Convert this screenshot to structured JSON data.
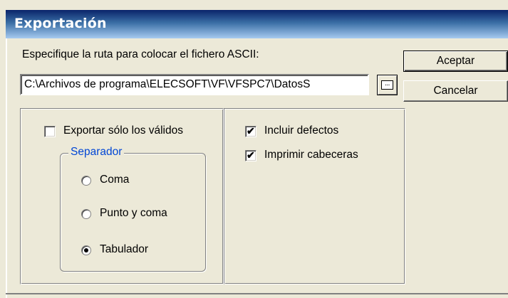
{
  "dialog": {
    "title": "Exportación"
  },
  "path_section": {
    "label": "Especifique la ruta para colocar el fichero ASCII:",
    "value": "C:\\Archivos de programa\\ELECSOFT\\VF\\VFSPC7\\DatosS",
    "browse_label": "..."
  },
  "buttons": {
    "ok": "Aceptar",
    "cancel": "Cancelar"
  },
  "options_left": {
    "only_valid": {
      "label": "Exportar sólo los válidos",
      "checked": false
    },
    "separator": {
      "label": "Separador",
      "options": [
        {
          "label": "Coma",
          "selected": false
        },
        {
          "label": "Punto y coma",
          "selected": false
        },
        {
          "label": "Tabulador",
          "selected": true
        }
      ]
    }
  },
  "options_right": {
    "include_defects": {
      "label": "Incluir defectos",
      "checked": true
    },
    "print_headers": {
      "label": "Imprimir cabeceras",
      "checked": true
    }
  },
  "check_mark": "✔",
  "colors": {
    "title_gradient_start": "#0A246A",
    "title_gradient_end": "#A6CAF0",
    "face": "#ECE9D8",
    "group_label": "#0046D5"
  }
}
